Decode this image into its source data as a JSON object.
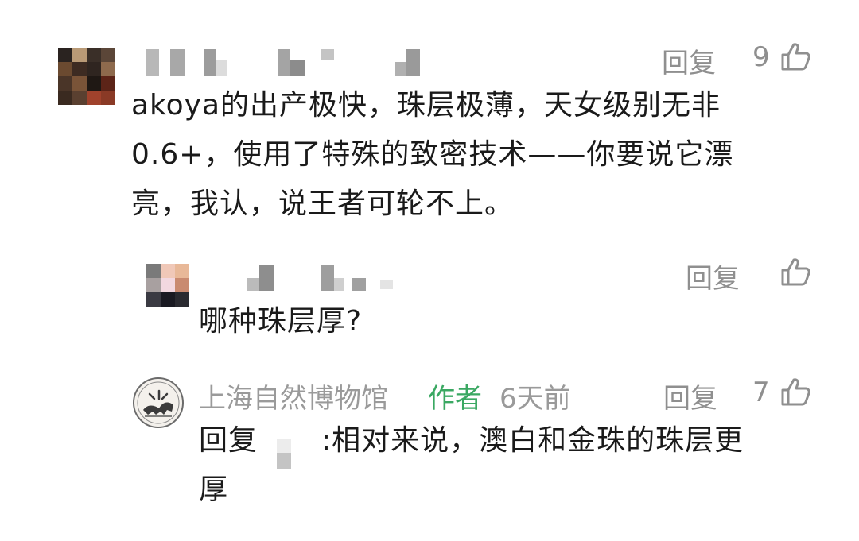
{
  "comments": [
    {
      "text_lines": [
        "akoya的出产极快，珠层极薄，天女级别无非",
        "0.6+，使用了特殊的致密技术——你要说它漂",
        "亮，我认，说王者可轮不上。"
      ],
      "reply_label": "回复",
      "like_count": "9"
    },
    {
      "text_lines": [
        "哪种珠层厚?"
      ],
      "reply_label": "回复",
      "like_count": ""
    },
    {
      "username": "上海自然博物馆",
      "author_badge": "作者",
      "time": "6天前",
      "reply_prefix": "回复",
      "text_lines": [
        ":相对来说，澳白和金珠的珠层更",
        "厚"
      ],
      "reply_label": "回复",
      "like_count": "7"
    }
  ],
  "colors": {
    "text": "#1a1a1a",
    "meta_gray": "#9a9a9a",
    "author_green": "#3aa862",
    "background": "#ffffff"
  },
  "icons": [
    "thumbs-up-icon",
    "museum-logo-icon"
  ]
}
